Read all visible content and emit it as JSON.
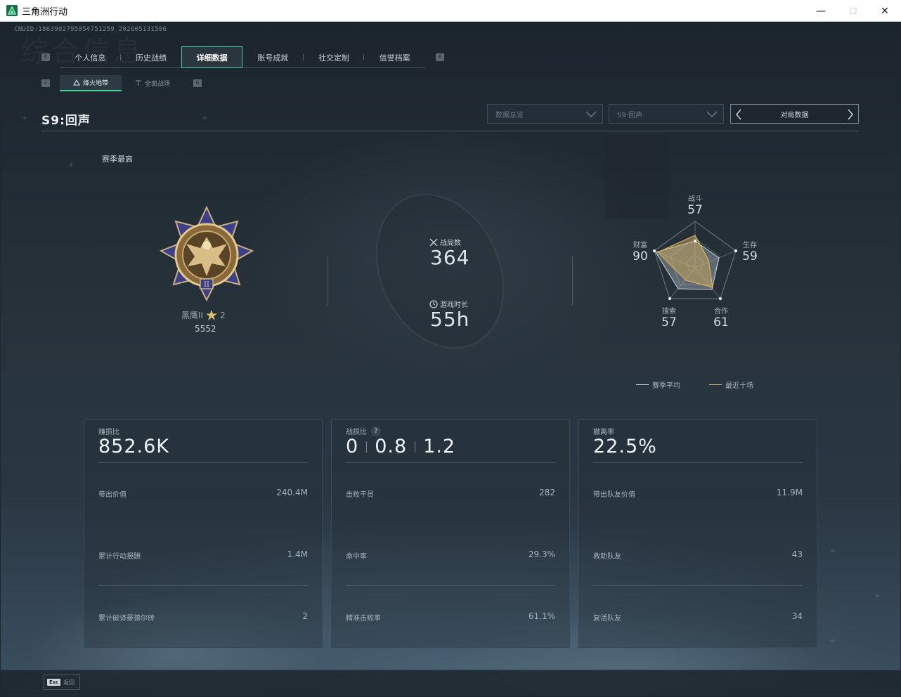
{
  "window": {
    "title": "三角洲行动",
    "min": "—",
    "max": "☐",
    "close": "✕"
  },
  "header": {
    "cnuid": "CNUID:186390279505475125​9_202605131506",
    "ghost_title": "综合信息",
    "key_left": "Q",
    "key_right": "E",
    "sub_key_left": "A",
    "sub_key_right": "D"
  },
  "tabs": [
    {
      "label": "个人信息"
    },
    {
      "label": "历史战绩"
    },
    {
      "label": "详细数据",
      "active": true
    },
    {
      "label": "账号成就"
    },
    {
      "label": "社交定制"
    },
    {
      "label": "信誉档案"
    }
  ],
  "subtabs": [
    {
      "label": "烽火地带",
      "icon": "operations-icon",
      "active": true
    },
    {
      "label": "全面战场",
      "icon": "battlefield-icon"
    }
  ],
  "season_title": "S9:回声",
  "filters": {
    "data_type": "数据总览",
    "season": "S9:回声",
    "match_button": "对局数据"
  },
  "season_high_label": "赛季最高",
  "rank": {
    "name": "黑鹰II",
    "stars": "2",
    "score": "5552",
    "star_color": "#d9c16a"
  },
  "stats": {
    "matches_label": "战局数",
    "matches_value": "364",
    "playtime_label": "游戏时长",
    "playtime_value": "55h"
  },
  "radar": {
    "combat_label": "战斗",
    "combat_value": "57",
    "survival_label": "生存",
    "survival_value": "59",
    "coop_label": "合作",
    "coop_value": "61",
    "search_label": "搜索",
    "search_value": "57",
    "wealth_label": "财富",
    "wealth_value": "90",
    "series": [
      {
        "name": "赛季平均",
        "color": "#cfd6db"
      },
      {
        "name": "最近十场",
        "color": "#d9b15a"
      }
    ]
  },
  "cards": [
    {
      "title": "赚损比",
      "big": "852.6K",
      "rows": [
        {
          "label": "带出价值",
          "value": "240.4M"
        },
        {
          "label": "累计行动报酬",
          "value": "1.4M"
        },
        {
          "label": "累计破译曼德尔砖",
          "value": "2"
        }
      ]
    },
    {
      "title": "战损比",
      "help": "?",
      "big_parts": [
        "0",
        "0.8",
        "1.2"
      ],
      "rows": [
        {
          "label": "击败干员",
          "value": "282"
        },
        {
          "label": "命中率",
          "value": "29.3%"
        },
        {
          "label": "精准击败率",
          "value": "61.1%"
        }
      ]
    },
    {
      "title": "撤离率",
      "big": "22.5%",
      "rows": [
        {
          "label": "带出队友价值",
          "value": "11.9M"
        },
        {
          "label": "救助队友",
          "value": "43"
        },
        {
          "label": "复活队友",
          "value": "34"
        }
      ]
    }
  ],
  "footer": {
    "esc_key": "Esc",
    "esc_label": "返回"
  },
  "accent": "#45d096"
}
